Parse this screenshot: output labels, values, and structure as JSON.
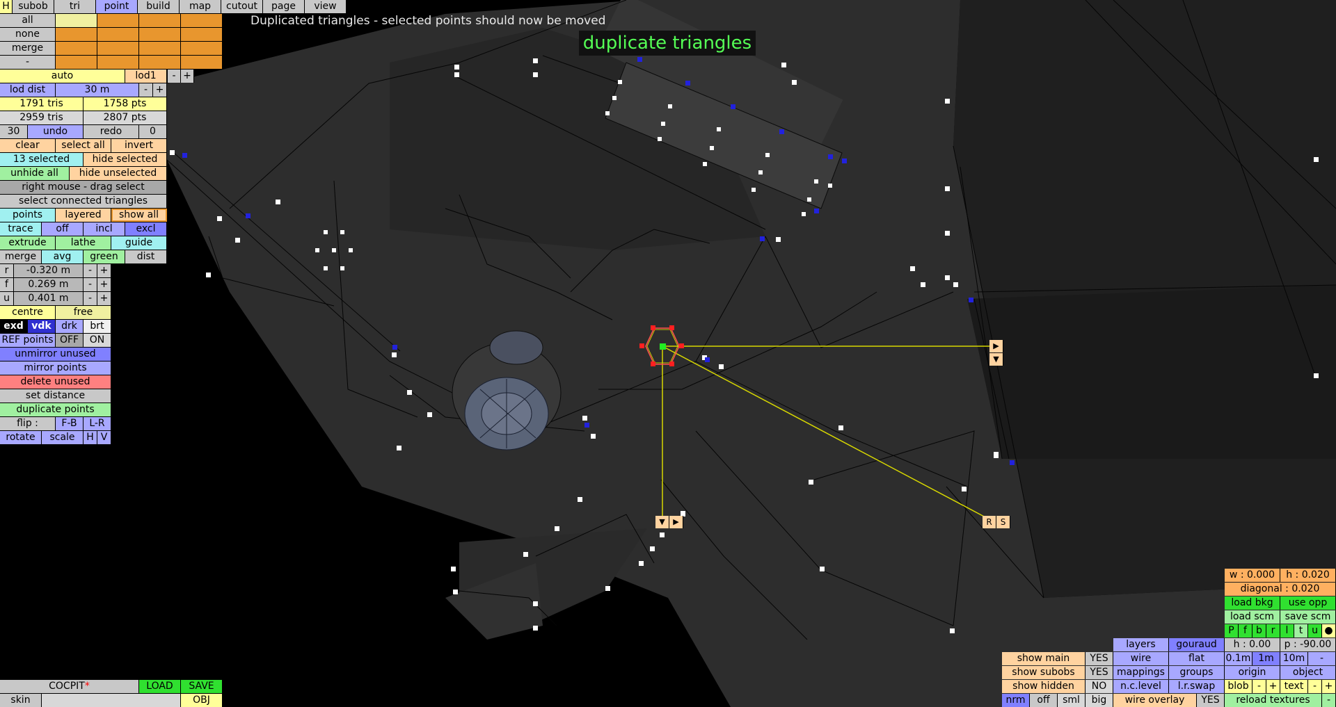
{
  "message": "Duplicated triangles - selected points should now be moved",
  "mode_banner": "duplicate triangles",
  "tabs": [
    "H",
    "subob",
    "tri",
    "point",
    "build",
    "map",
    "cutout",
    "page",
    "view"
  ],
  "select_rows": [
    "all",
    "none",
    "merge",
    "-"
  ],
  "auto": {
    "label": "auto",
    "lod": "lod1",
    "minus": "-",
    "plus": "+"
  },
  "lod_dist": {
    "label": "lod dist",
    "value": "30 m",
    "minus": "-",
    "plus": "+"
  },
  "stats": {
    "tris1": "1791 tris",
    "pts1": "1758 pts",
    "tris2": "2959 tris",
    "pts2": "2807 pts"
  },
  "undo_row": {
    "count": "30",
    "undo": "undo",
    "redo": "redo",
    "redo_count": "0"
  },
  "sel_row": {
    "clear": "clear",
    "select_all": "select all",
    "invert": "invert"
  },
  "selected_row": {
    "selected": "13 selected",
    "hide_selected": "hide selected"
  },
  "unhide_row": {
    "unhide_all": "unhide all",
    "hide_unselected": "hide unselected"
  },
  "right_mouse": "right mouse - drag select",
  "select_connected": "select connected triangles",
  "points_row": {
    "points": "points",
    "layered": "layered",
    "show_all": "show all"
  },
  "trace_row": {
    "trace": "trace",
    "off": "off",
    "incl": "incl",
    "excl": "excl"
  },
  "extrude_row": {
    "extrude": "extrude",
    "lathe": "lathe",
    "guide": "guide"
  },
  "merge_row": {
    "merge": "merge",
    "avg": "avg",
    "green": "green",
    "dist": "dist"
  },
  "coords": [
    {
      "axis": "r",
      "value": "-0.320 m"
    },
    {
      "axis": "f",
      "value": "0.269 m"
    },
    {
      "axis": "u",
      "value": "0.401 m"
    }
  ],
  "pm": {
    "minus": "-",
    "plus": "+"
  },
  "centre_row": {
    "centre": "centre",
    "free": "free"
  },
  "shade_row": {
    "exd": "exd",
    "vdk": "vdk",
    "drk": "drk",
    "brt": "brt"
  },
  "ref_row": {
    "label": "REF points",
    "off": "OFF",
    "on": "ON"
  },
  "point_ops": [
    "unmirror unused",
    "mirror points",
    "delete unused",
    "set distance",
    "duplicate points"
  ],
  "flip_row": {
    "flip": "flip :",
    "fb": "F-B",
    "lr": "L-R"
  },
  "rotate_row": {
    "rotate": "rotate",
    "scale": "scale",
    "h": "H",
    "v": "V"
  },
  "file": {
    "name": "COCPIT",
    "modified": "*",
    "load": "LOAD",
    "save": "SAVE",
    "skin": "skin",
    "obj": "OBJ"
  },
  "gizmo": {
    "right_arrow": "▶",
    "down_arrow": "▼",
    "r": "R",
    "s": "S"
  },
  "right_panel": {
    "w": "w : 0.000",
    "h": "h : 0.020",
    "diagonal": "diagonal : 0.020",
    "load_bkg": "load bkg",
    "use_opp": "use opp",
    "load_scm": "load scm",
    "save_scm": "save scm",
    "views": [
      "P",
      "f",
      "b",
      "r",
      "l",
      "t",
      "u",
      "●"
    ],
    "h_val": "h : 0.00",
    "p_val": "p : -90.00",
    "grid": [
      "0.1m",
      "1m",
      "10m",
      "-"
    ],
    "origin": "origin",
    "object": "object",
    "blob": "blob",
    "text": "text",
    "minus": "-",
    "plus": "+",
    "reload": "reload textures"
  },
  "display_panel": {
    "show_main": "show main",
    "yes1": "YES",
    "show_subobs": "show subobs",
    "yes2": "YES",
    "show_hidden": "show hidden",
    "no": "NO",
    "nrm": "nrm",
    "off": "off",
    "sml": "sml",
    "big": "big",
    "layers": "layers",
    "gouraud": "gouraud",
    "wire": "wire",
    "flat": "flat",
    "mappings": "mappings",
    "groups": "groups",
    "nc_level": "n.c.level",
    "lr_swap": "l.r.swap",
    "wire_overlay": "wire overlay",
    "yes3": "YES"
  }
}
